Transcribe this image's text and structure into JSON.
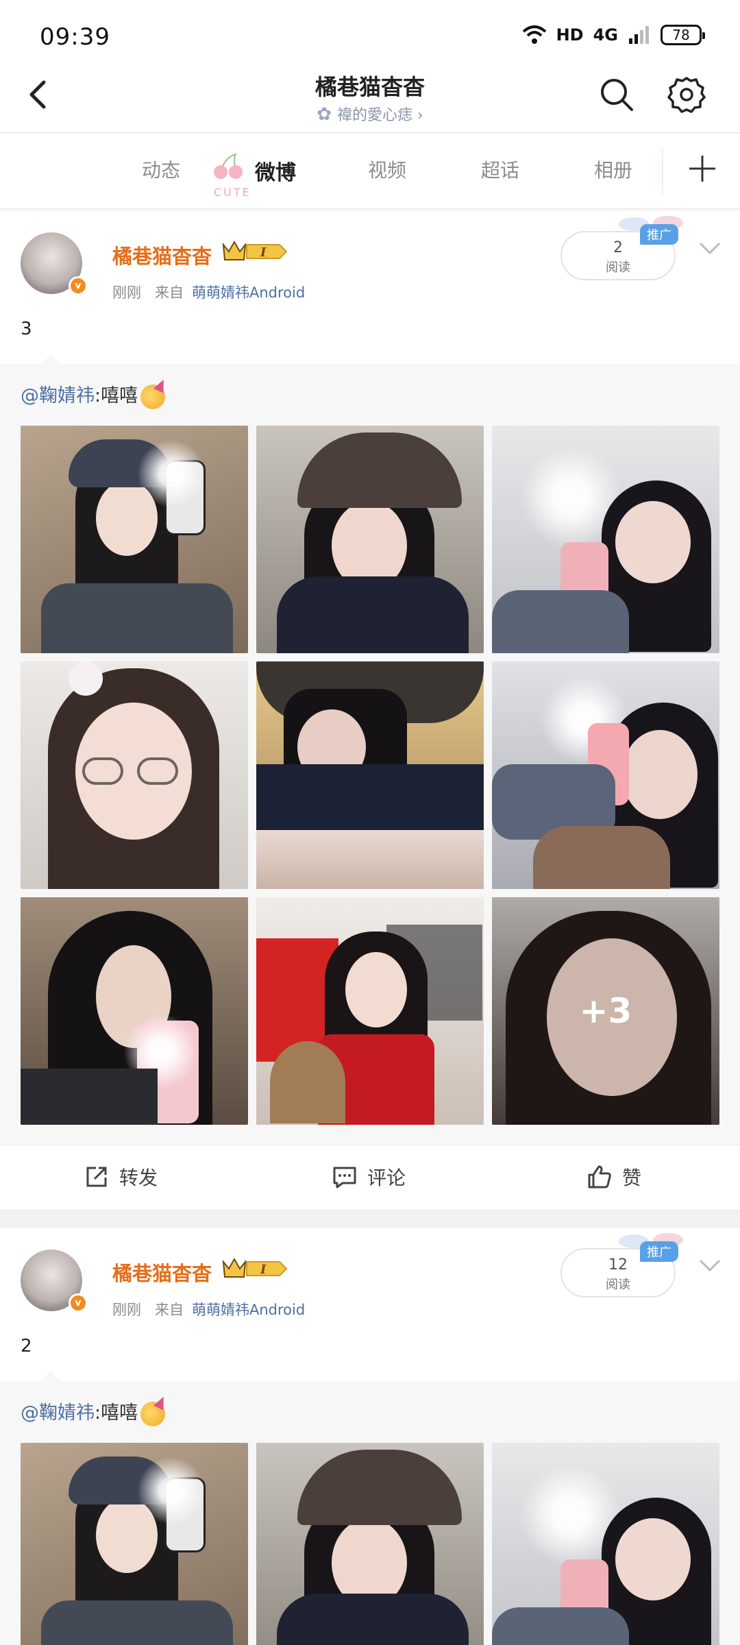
{
  "status_bar": {
    "time": "09:39",
    "network": "HD",
    "signal": "4G",
    "battery": "78"
  },
  "header": {
    "title": "橘巷猫杳杳",
    "subtitle": "禕的愛心痣",
    "subtitle_arrow": "›"
  },
  "tabs": [
    {
      "label": "动态"
    },
    {
      "label": "微博",
      "active": true,
      "decoration": "CUTE"
    },
    {
      "label": "视频"
    },
    {
      "label": "超话"
    },
    {
      "label": "相册"
    }
  ],
  "posts": [
    {
      "author": "橘巷猫杳杳",
      "vip_level": "I",
      "time": "刚刚",
      "source_prefix": "来自",
      "source": "萌萌婧祎Android",
      "read_count": "2",
      "read_label": "阅读",
      "promo": "推广",
      "verified": "v",
      "text": "3",
      "repost": {
        "mention": "@鞠婧祎",
        "text": ":嘻嘻"
      },
      "images_more": "+3",
      "actions": {
        "repost": "转发",
        "comment": "评论",
        "like": "赞"
      }
    },
    {
      "author": "橘巷猫杳杳",
      "vip_level": "I",
      "time": "刚刚",
      "source_prefix": "来自",
      "source": "萌萌婧祎Android",
      "read_count": "12",
      "read_label": "阅读",
      "promo": "推广",
      "verified": "v",
      "text": "2",
      "repost": {
        "mention": "@鞠婧祎",
        "text": ":嘻嘻"
      }
    }
  ],
  "colors": {
    "accent_orange": "#e66e17",
    "link_blue": "#4d6fa3",
    "promo_blue": "#5aa0e6"
  }
}
